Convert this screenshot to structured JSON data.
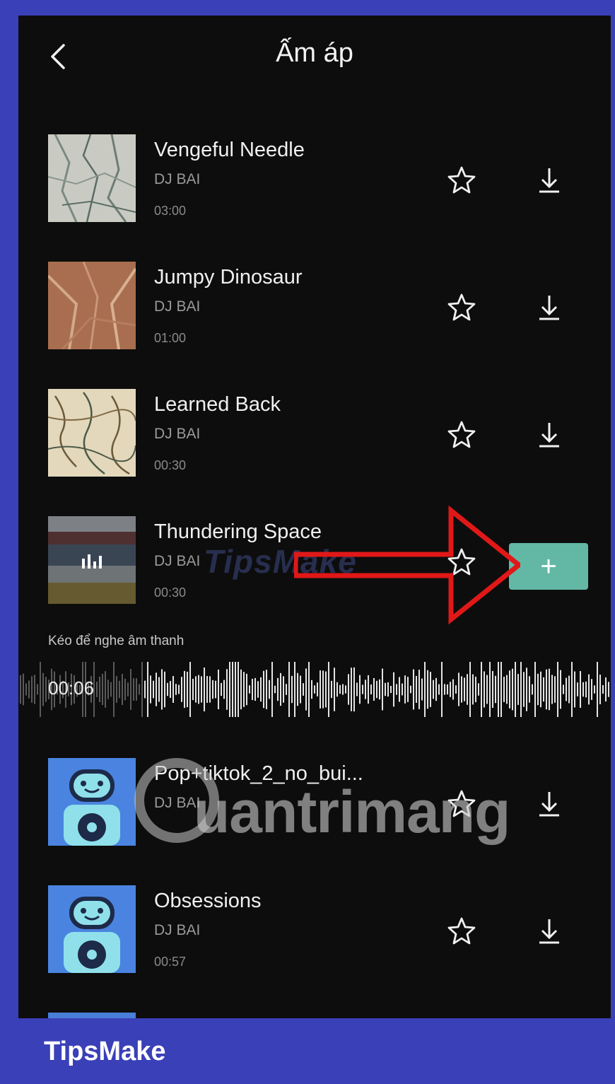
{
  "header": {
    "title": "Ấm áp"
  },
  "tracks": [
    {
      "name": "Vengeful Needle",
      "artist": "DJ BAI",
      "duration": "03:00"
    },
    {
      "name": "Jumpy Dinosaur",
      "artist": "DJ BAI",
      "duration": "01:00"
    },
    {
      "name": "Learned Back",
      "artist": "DJ BAI",
      "duration": "00:30"
    },
    {
      "name": "Thundering Space",
      "artist": "DJ BAI",
      "duration": "00:30",
      "playing": true
    },
    {
      "name": "Pop+tiktok_2_no_bui...",
      "artist": "DJ BAI",
      "duration": ""
    },
    {
      "name": "Obsessions",
      "artist": "DJ BAI",
      "duration": "00:57"
    }
  ],
  "player": {
    "hint": "Kéo để nghe âm thanh",
    "position": "00:06"
  },
  "add_button_label": "+",
  "watermarks": {
    "top": "TipsMake",
    "bottom": "uantrimang"
  },
  "footer": {
    "brand": "TipsMake"
  },
  "colors": {
    "frame": "#3a40b8",
    "screen": "#0d0d0d",
    "add_button": "#63b8a5",
    "arrow": "#e01818"
  },
  "icons": [
    "back-arrow-icon",
    "star-outline-icon",
    "download-icon",
    "plus-icon",
    "equalizer-icon"
  ]
}
